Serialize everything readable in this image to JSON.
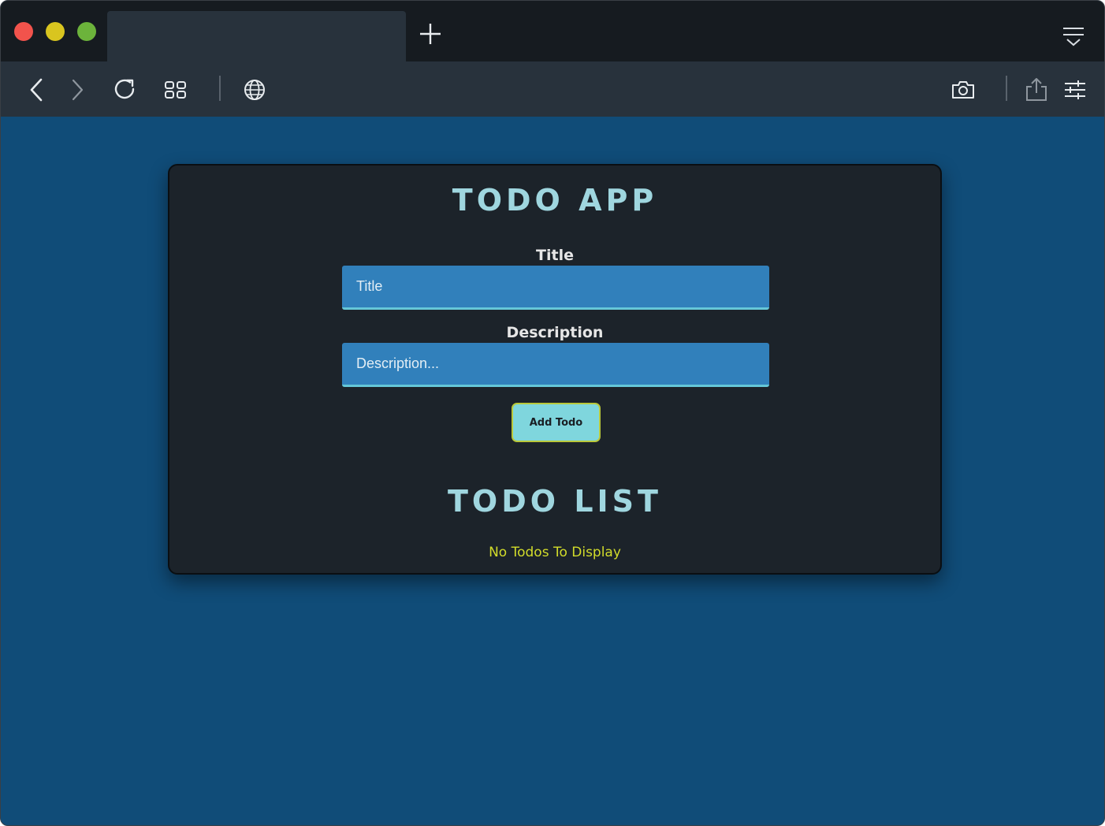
{
  "browser": {
    "tab_title": "",
    "icons": {
      "new_tab": "plus-icon",
      "tab_menu": "tab-menu-icon",
      "back": "back-icon",
      "forward": "forward-icon",
      "reload": "reload-icon",
      "tabs_overview": "grid-icon",
      "site": "globe-icon",
      "screenshot": "camera-icon",
      "share": "share-icon",
      "settings": "sliders-icon"
    }
  },
  "app": {
    "heading": "TODO APP",
    "title_label": "Title",
    "title_placeholder": "Title",
    "title_value": "",
    "description_label": "Description",
    "description_placeholder": "Description...",
    "description_value": "",
    "add_button": "Add Todo",
    "list_heading": "TODO LIST",
    "empty_message": "No Todos To Display"
  },
  "colors": {
    "page_background": "#104c78",
    "card_background": "#1c232a",
    "heading": "#9fd6df",
    "input_background": "#3180bb",
    "button_background": "#7fd6dd",
    "empty_message": "#d2dc2a"
  }
}
